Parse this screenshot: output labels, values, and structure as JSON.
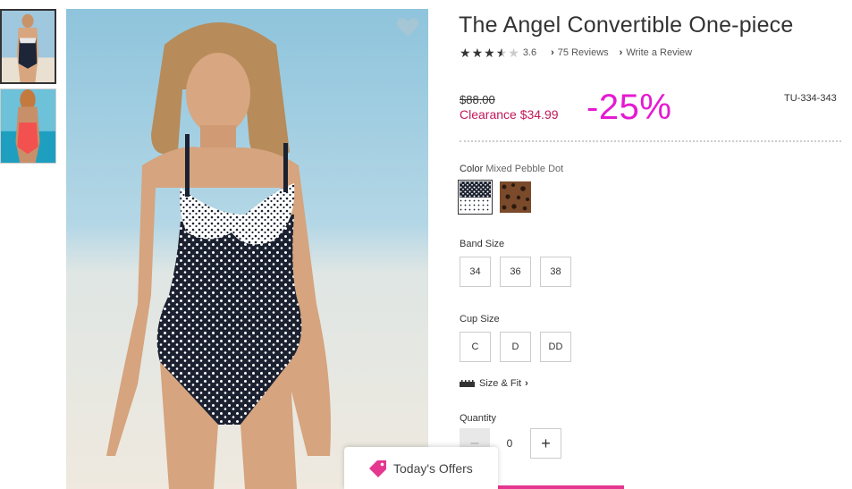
{
  "product": {
    "title": "The Angel Convertible One-piece",
    "rating": "3.6",
    "rating_value": 3.6,
    "reviews_link": "75 Reviews",
    "write_review_link": "Write a Review",
    "original_price": "$88.00",
    "clearance_price": "Clearance $34.99",
    "discount": "-25%",
    "sku": "TU-334-343"
  },
  "color": {
    "label": "Color",
    "selected": "Mixed Pebble Dot",
    "swatches": [
      "mixed-pebble-dot",
      "leopard"
    ]
  },
  "band_size": {
    "label": "Band Size",
    "options": [
      "34",
      "36",
      "38"
    ]
  },
  "cup_size": {
    "label": "Cup Size",
    "options": [
      "C",
      "D",
      "DD"
    ]
  },
  "size_fit": "Size & Fit",
  "quantity": {
    "label": "Quantity",
    "value": "0",
    "minus": "–",
    "plus": "+"
  },
  "offers": {
    "label": "Today's Offers"
  },
  "colors": {
    "discount": "#e51ad2",
    "clearance": "#c2185b",
    "brand_pink": "#e5378f"
  },
  "icons": [
    "heart-icon",
    "star-icon",
    "chevron-right-icon",
    "ruler-icon",
    "tag-icon"
  ]
}
